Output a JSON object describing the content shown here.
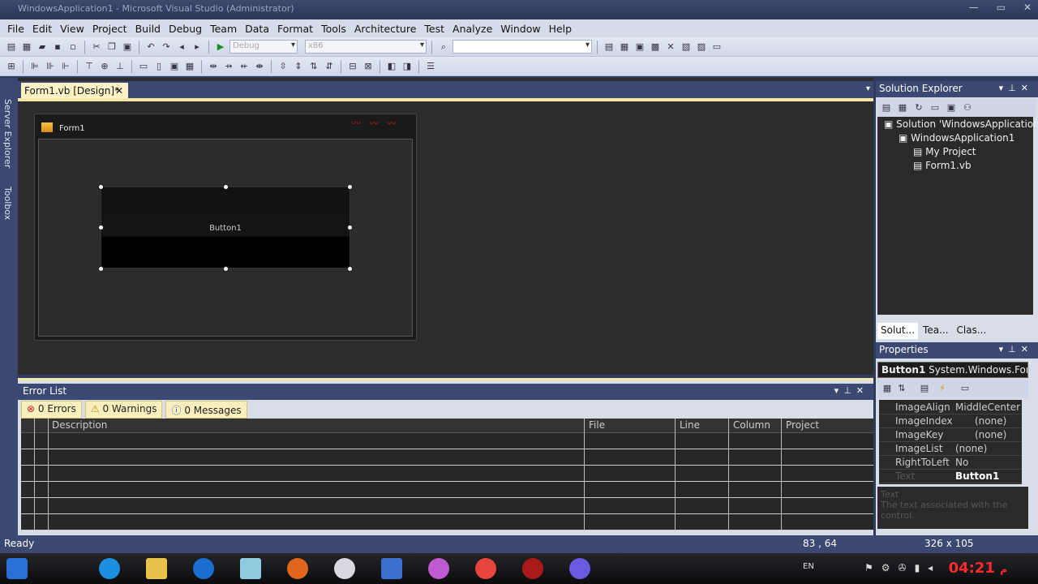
{
  "window": {
    "title": "WindowsApplication1 - Microsoft Visual Studio (Administrator)",
    "controls": [
      "—",
      "▭",
      "✕"
    ]
  },
  "menu": [
    "File",
    "Edit",
    "View",
    "Project",
    "Build",
    "Debug",
    "Team",
    "Data",
    "Format",
    "Tools",
    "Architecture",
    "Test",
    "Analyze",
    "Window",
    "Help"
  ],
  "toolbar": {
    "config_value": "Debug",
    "platform_value": "x86",
    "find_value": ""
  },
  "left_rail": {
    "server_explorer": "Server Explorer",
    "toolbox": "Toolbox"
  },
  "doc_tab": {
    "label": "Form1.vb [Design]*",
    "close": "✕"
  },
  "designer": {
    "form_title": "Form1",
    "button_text": "Button1"
  },
  "error_list": {
    "title": "Error List",
    "errors": "0 Errors",
    "warnings": "0 Warnings",
    "messages": "0 Messages",
    "columns": [
      "Description",
      "File",
      "Line",
      "Column",
      "Project"
    ]
  },
  "solution_explorer": {
    "title": "Solution Explorer",
    "items": [
      "Solution 'WindowsApplication",
      "WindowsApplication1",
      "My Project",
      "Form1.vb"
    ],
    "tabs": [
      "Solut...",
      "Tea...",
      "Clas..."
    ]
  },
  "properties": {
    "title": "Properties",
    "object_name": "Button1",
    "object_type": "System.Windows.Forr",
    "rows": [
      {
        "name": "ImageAlign",
        "value": "MiddleCenter"
      },
      {
        "name": "ImageIndex",
        "value": "(none)"
      },
      {
        "name": "ImageKey",
        "value": "(none)"
      },
      {
        "name": "ImageList",
        "value": "(none)"
      },
      {
        "name": "RightToLeft",
        "value": "No"
      },
      {
        "name": "Text",
        "value": "Button1"
      }
    ],
    "desc_title": "Text",
    "desc_body": "The text associated with the control."
  },
  "status": {
    "text": "Ready",
    "position": "83 , 64",
    "size": "326 x 105"
  },
  "taskbar": {
    "lang": "EN",
    "clock": "04:21",
    "ampm": "م"
  }
}
